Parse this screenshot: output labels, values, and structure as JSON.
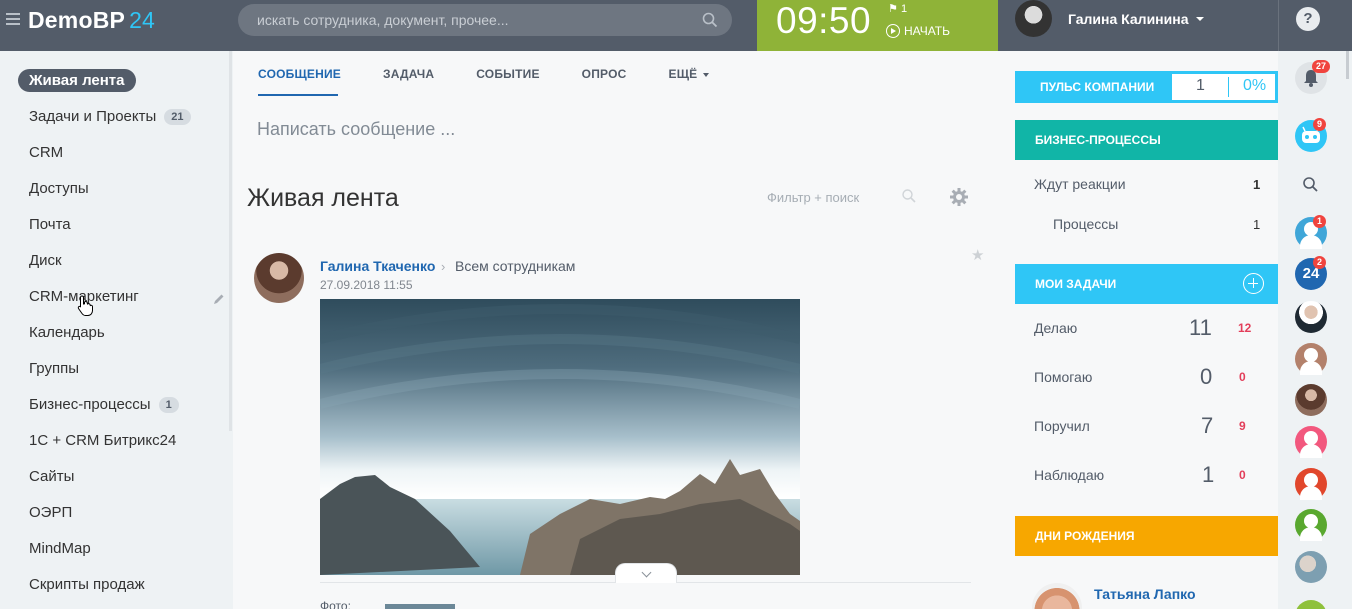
{
  "header": {
    "logo_main": "DemoBP",
    "logo_num": "24",
    "search_placeholder": "искать сотрудника, документ, прочее...",
    "time": "09:50",
    "flag_count": "1",
    "start_label": "НАЧАТЬ",
    "user_name": "Галина Калинина",
    "help_label": "?"
  },
  "menu": {
    "items": [
      {
        "label": "Живая лента"
      },
      {
        "label": "Задачи и Проекты",
        "count": "21"
      },
      {
        "label": "CRM"
      },
      {
        "label": "Доступы"
      },
      {
        "label": "Почта"
      },
      {
        "label": "Диск"
      },
      {
        "label": "CRM-маркетинг"
      },
      {
        "label": "Календарь"
      },
      {
        "label": "Группы"
      },
      {
        "label": "Бизнес-процессы",
        "count": "1"
      },
      {
        "label": "1С + CRM Битрикс24"
      },
      {
        "label": "Сайты"
      },
      {
        "label": "ОЭРП"
      },
      {
        "label": "MindMap"
      },
      {
        "label": "Скрипты продаж"
      }
    ]
  },
  "composer": {
    "tabs": [
      "СООБЩЕНИЕ",
      "ЗАДАЧА",
      "СОБЫТИЕ",
      "ОПРОС",
      "ЕЩЁ"
    ],
    "placeholder": "Написать сообщение ..."
  },
  "feed": {
    "title": "Живая лента",
    "filter_label": "Фильтр + поиск",
    "post": {
      "author": "Галина Ткаченко",
      "destination": "Всем сотрудникам",
      "date": "27.09.2018 11:55",
      "photo_label": "Фото:"
    }
  },
  "pulse": {
    "label": "ПУЛЬС КОМПАНИИ",
    "value": "1",
    "percent": "0%"
  },
  "bizproc": {
    "label": "БИЗНЕС-ПРОЦЕССЫ",
    "rows": [
      {
        "label": "Ждут реакции",
        "value": "1"
      },
      {
        "label": "Процессы",
        "value": "1"
      }
    ]
  },
  "tasks": {
    "label": "МОИ ЗАДАЧИ",
    "rows": [
      {
        "label": "Делаю",
        "value": "11",
        "overdue": "12"
      },
      {
        "label": "Помогаю",
        "value": "0",
        "overdue": "0"
      },
      {
        "label": "Поручил",
        "value": "7",
        "overdue": "9"
      },
      {
        "label": "Наблюдаю",
        "value": "1",
        "overdue": "0"
      }
    ]
  },
  "birthdays": {
    "label": "ДНИ РОЖДЕНИЯ",
    "person": "Татьяна Лапко"
  },
  "rightbar": {
    "notifications_badge": "27",
    "chat_badge": "9",
    "contact1_badge": "1",
    "contact2_badge": "2",
    "contact2_label": "24"
  },
  "colors": {
    "header": "#535c69",
    "clock": "#8fb338",
    "accent": "#2fc6f6",
    "bizproc": "#11b5a7",
    "birthday": "#f7a700",
    "link": "#2067b0",
    "badge": "#f0443e"
  }
}
